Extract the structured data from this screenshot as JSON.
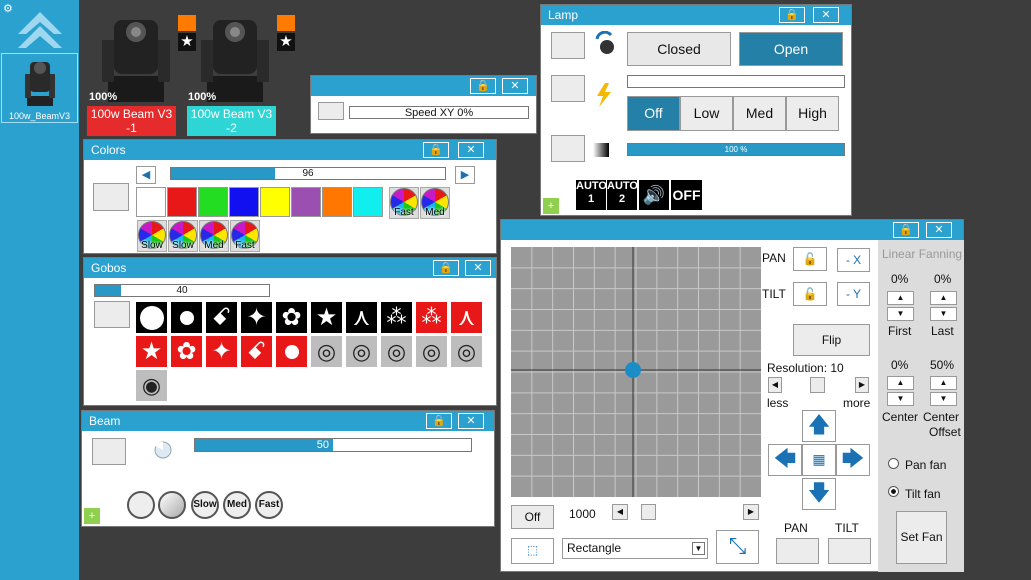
{
  "sidebar": {
    "fixture_label": "100w_BeamV3"
  },
  "fixtures": [
    {
      "percent": "100%",
      "label": "100w Beam V3 -1",
      "color": "#e52b2b"
    },
    {
      "percent": "100%",
      "label": "100w Beam V3 -2",
      "color": "#2fd4d4"
    }
  ],
  "speed_window": {
    "bar_text": "Speed XY    0%"
  },
  "lamp_window": {
    "title": "Lamp",
    "closed_label": "Closed",
    "open_label": "Open",
    "off_label": "Off",
    "low_label": "Low",
    "med_label": "Med",
    "high_label": "High",
    "dimmer_text": "100 %",
    "dimmer_value": 100,
    "auto1_top": "AUTO",
    "auto1_bottom": "1",
    "auto2_top": "AUTO",
    "auto2_bottom": "2",
    "off_icon_label": "OFF"
  },
  "colors_window": {
    "title": "Colors",
    "slider_text": "96",
    "slider_value": 38,
    "swatches": [
      "#ffffff",
      "#e81818",
      "#22dd22",
      "#1010f0",
      "#ffff00",
      "#9b4fb0",
      "#ff7700",
      "#11eeee"
    ],
    "wheel_labels": [
      "Fast",
      "Med",
      "Slow",
      "Slow",
      "Med",
      "Fast"
    ]
  },
  "gobos_window": {
    "title": "Gobos",
    "slider_text": "40",
    "slider_value": 15
  },
  "beam_window": {
    "title": "Beam",
    "slider_text": "50",
    "slider_value": 50,
    "buttons": [
      "",
      "",
      "Slow",
      "Med",
      "Fast"
    ]
  },
  "pantilt_window": {
    "pan_label": "PAN",
    "tilt_label": "TILT",
    "minus_x": "- X",
    "minus_y": "- Y",
    "flip_label": "Flip",
    "resolution_label": "Resolution: 10",
    "less_label": "less",
    "more_label": "more",
    "off_label": "Off",
    "speed_value": "1000",
    "shape_select": "Rectangle",
    "pan_bottom": "PAN",
    "tilt_bottom": "TILT"
  },
  "fanning": {
    "title": "Linear Fanning",
    "first_pct": "0%",
    "last_pct": "0%",
    "first_label": "First",
    "last_label": "Last",
    "center_pct": "0%",
    "offset_pct": "50%",
    "center_label": "Center",
    "offset_label_1": "Center",
    "offset_label_2": "Offset",
    "pan_fan_label": "Pan fan",
    "tilt_fan_label": "Tilt fan",
    "set_fan_label": "Set Fan"
  }
}
